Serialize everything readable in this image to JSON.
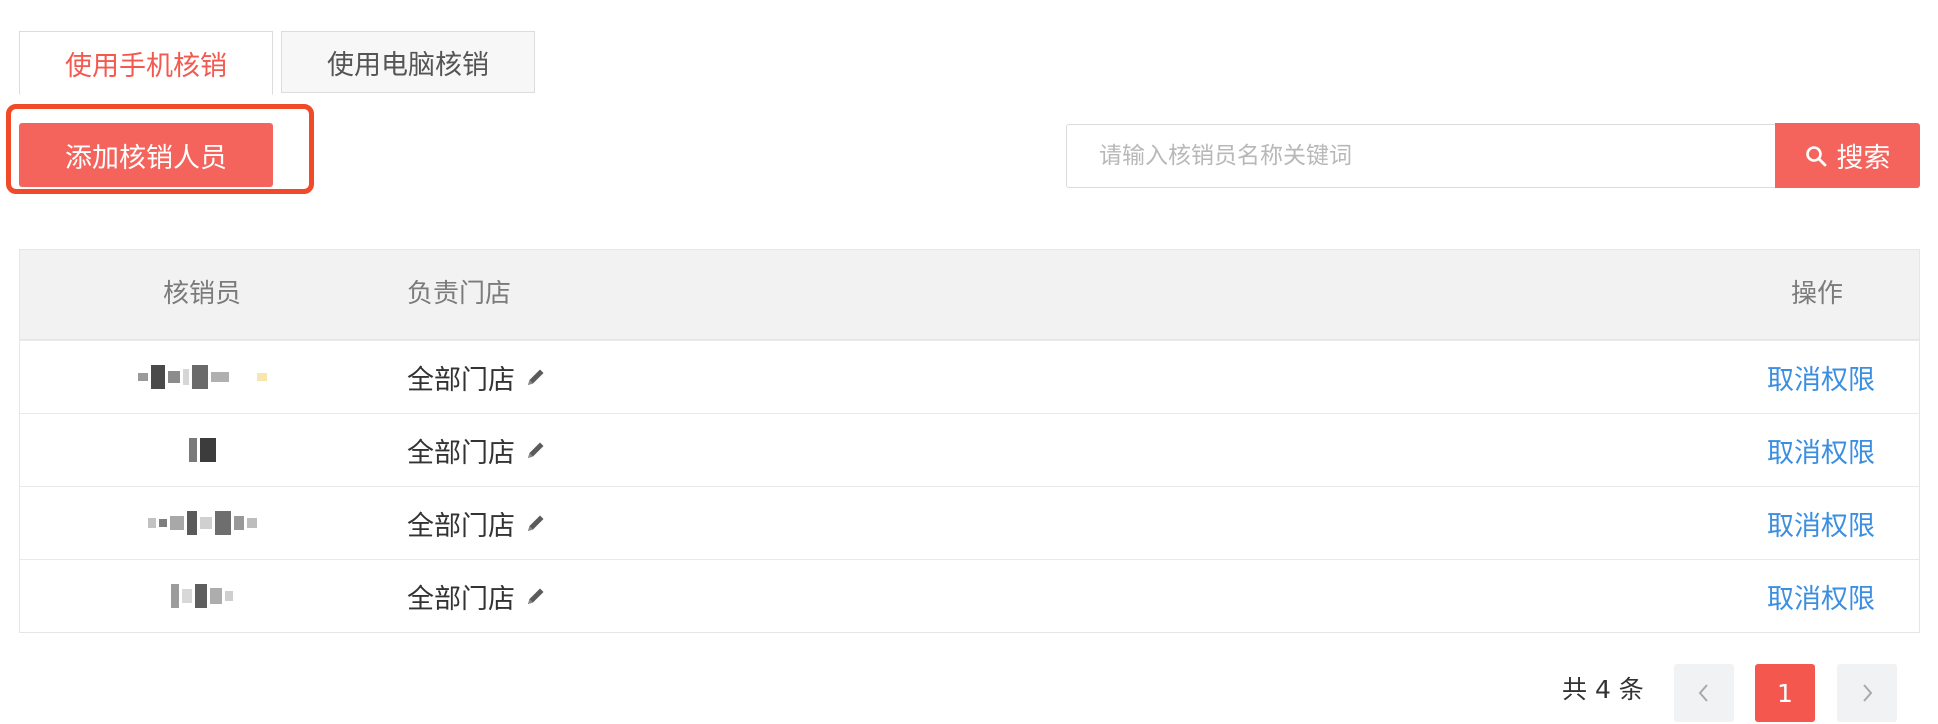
{
  "tabs": [
    {
      "label": "使用手机核销",
      "active": true
    },
    {
      "label": "使用电脑核销",
      "active": false
    }
  ],
  "toolbar": {
    "add_button_label": "添加核销人员"
  },
  "search": {
    "placeholder": "请输入核销员名称关键词",
    "button_label": "搜索",
    "icon": "search-icon"
  },
  "table": {
    "headers": {
      "name": "核销员",
      "store": "负责门店",
      "action": "操作"
    },
    "rows": [
      {
        "name": "",
        "store": "全部门店",
        "action": "取消权限"
      },
      {
        "name": "",
        "store": "全部门店",
        "action": "取消权限"
      },
      {
        "name": "",
        "store": "全部门店",
        "action": "取消权限"
      },
      {
        "name": "",
        "store": "全部门店",
        "action": "取消权限"
      }
    ]
  },
  "pagination": {
    "total_text": "共 4 条",
    "current_page": "1",
    "prev_icon": "chevron-left-icon",
    "next_icon": "chevron-right-icon"
  },
  "colors": {
    "accent": "#f4645d",
    "active_tab_text": "#f4594f",
    "highlight_border": "#f04a28",
    "link": "#3c8fe0"
  }
}
